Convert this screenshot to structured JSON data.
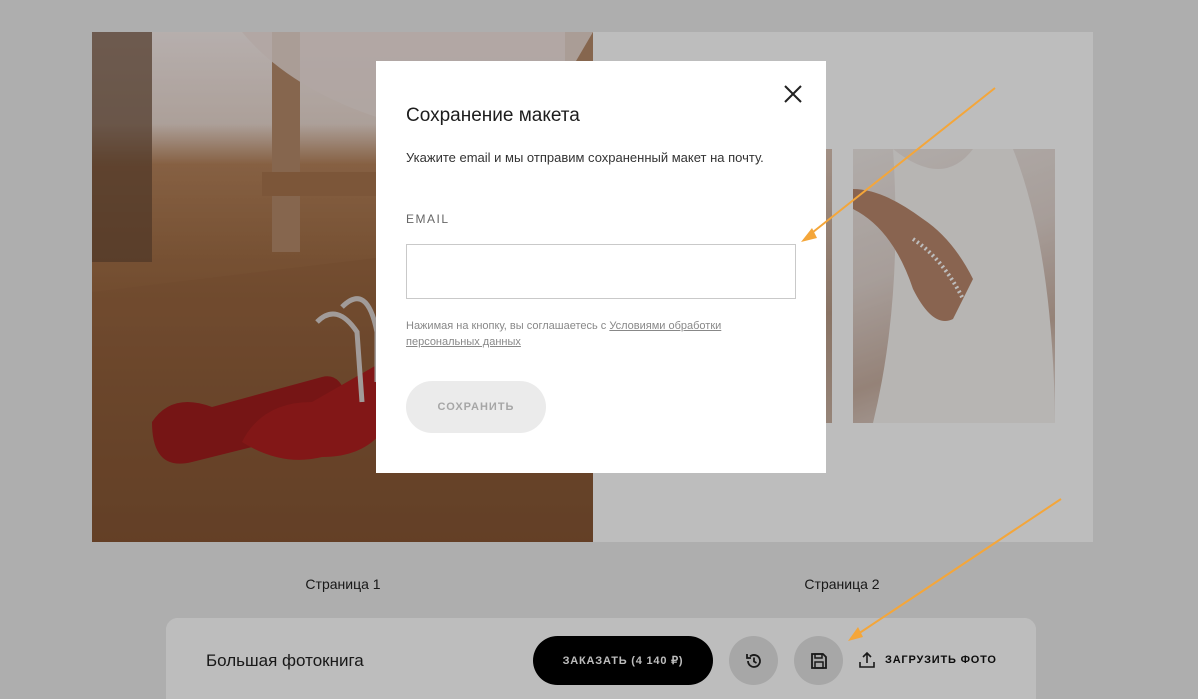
{
  "spread": {
    "pages": [
      {
        "label": "Страница 1"
      },
      {
        "label": "Страница 2"
      }
    ]
  },
  "modal": {
    "title": "Сохранение макета",
    "description": "Укажите email и мы отправим сохраненный макет на почту.",
    "email_label": "EMAIL",
    "email_value": "",
    "consent_text": "Нажимая на кнопку, вы соглашаетесь с ",
    "consent_link": "Условиями обработки персональных данных",
    "save_button": "СОХРАНИТЬ",
    "close_icon": "close-icon"
  },
  "bottom_bar": {
    "product_name": "Большая фотокнига",
    "order_button": "ЗАКАЗАТЬ (4 140 ₽)",
    "history_icon": "history-icon",
    "save_icon": "floppy-disk-icon",
    "upload_label": "ЗАГРУЗИТЬ ФОТО",
    "upload_icon": "upload-icon"
  },
  "colors": {
    "annotation_arrow": "#f4a63a",
    "order_button_bg": "#000000",
    "backdrop": "#000000"
  }
}
